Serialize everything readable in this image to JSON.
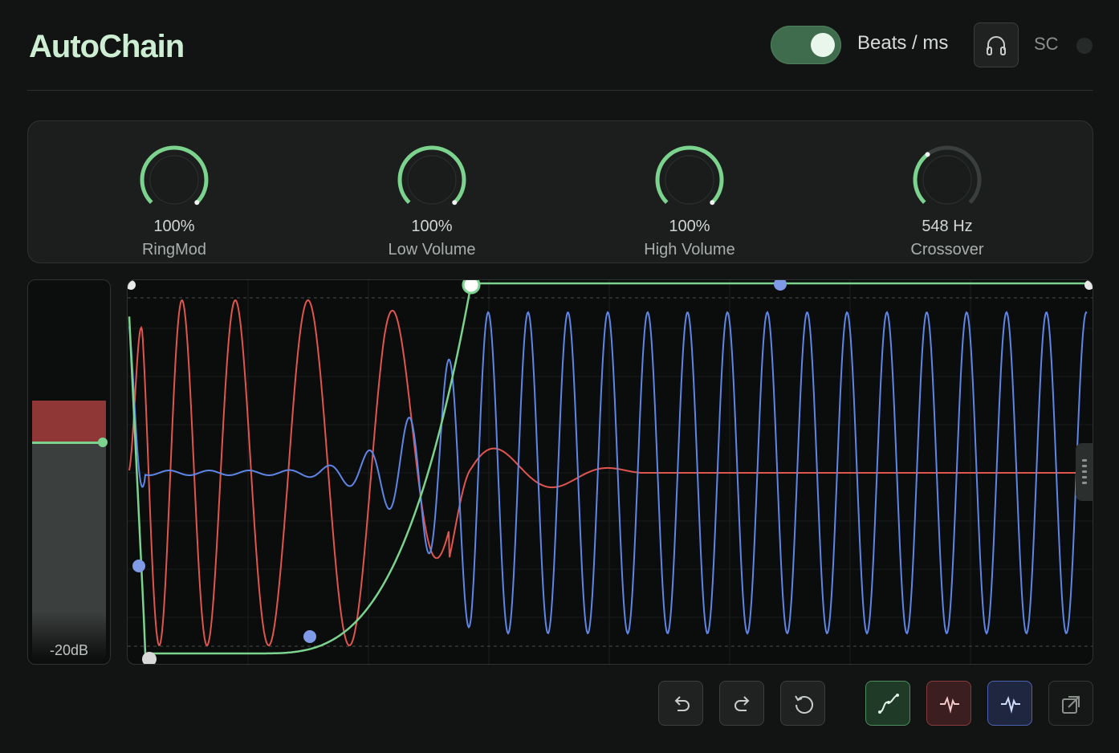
{
  "app": {
    "title": "AutoChain"
  },
  "header": {
    "toggle_on": true,
    "toggle_label": "Beats / ms",
    "headphones_icon": "headphones-icon",
    "sc_label": "SC",
    "sc_led_active": false
  },
  "knobs": [
    {
      "value": "100%",
      "label": "RingMod",
      "fraction": 1.0
    },
    {
      "value": "100%",
      "label": "Low Volume",
      "fraction": 1.0
    },
    {
      "value": "100%",
      "label": "High Volume",
      "fraction": 1.0
    },
    {
      "value": "548 Hz",
      "label": "Crossover",
      "fraction": 0.36
    }
  ],
  "meter": {
    "label": "-20dB",
    "level_fraction": 0.58,
    "threshold_fraction": 0.58,
    "peak_fraction": 0.69
  },
  "colors": {
    "accent_green": "#7bd38e",
    "wave_red": "#e0564f",
    "wave_blue": "#5f86e6",
    "point_blue": "#7f9be8",
    "point_grey": "#d9d9d9"
  },
  "toolbar": {
    "undo_icon": "undo-icon",
    "redo_icon": "redo-icon",
    "reset_icon": "reset-icon",
    "curve_icon": "curve-icon",
    "low_wave_icon": "low-band-wave-icon",
    "high_wave_icon": "high-band-wave-icon",
    "popout_icon": "popout-icon"
  }
}
